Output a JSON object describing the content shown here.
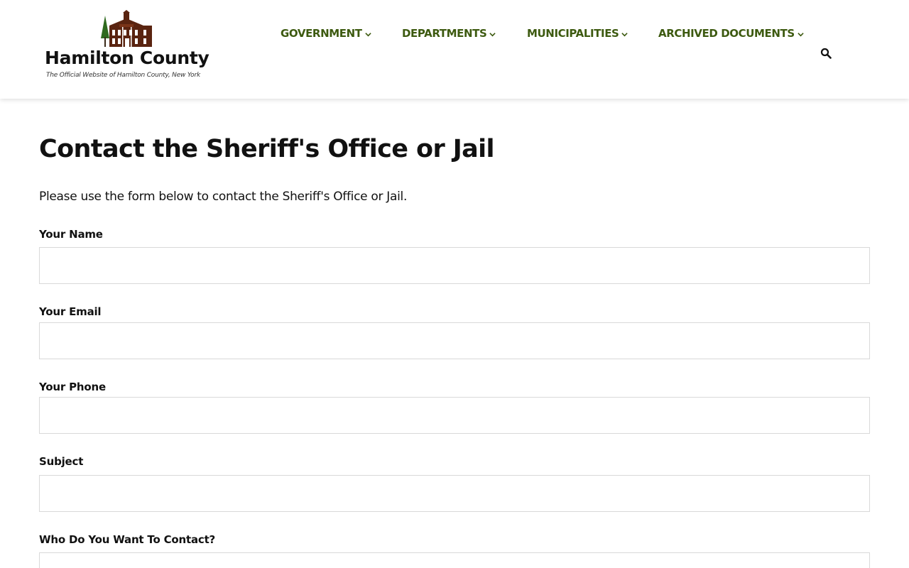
{
  "site": {
    "logo_title": "Hamilton County",
    "logo_tagline": "The Official Website of Hamilton County, New York",
    "colors": {
      "nav_text": "#3d5a10",
      "logo_building": "#5a2410",
      "logo_tree": "#2f6a1e"
    }
  },
  "nav": {
    "items": [
      {
        "label": "GOVERNMENT",
        "icon": "chevron-down-icon"
      },
      {
        "label": "DEPARTMENTS",
        "icon": "chevron-down-icon"
      },
      {
        "label": "MUNICIPALITIES",
        "icon": "chevron-down-icon"
      },
      {
        "label": "ARCHIVED DOCUMENTS",
        "icon": "chevron-down-icon"
      }
    ],
    "search_icon": "search-icon"
  },
  "main": {
    "title": "Contact the Sheriff's Office or Jail",
    "intro": "Please use the form below to contact the Sheriff's Office or Jail.",
    "fields": [
      {
        "label": "Your Name",
        "value": "",
        "placeholder": ""
      },
      {
        "label": "Your Email",
        "value": "",
        "placeholder": ""
      },
      {
        "label": "Your Phone",
        "value": "",
        "placeholder": ""
      },
      {
        "label": "Subject",
        "value": "",
        "placeholder": ""
      },
      {
        "label": "Who Do You Want To Contact?",
        "value": "",
        "placeholder": ""
      }
    ]
  }
}
